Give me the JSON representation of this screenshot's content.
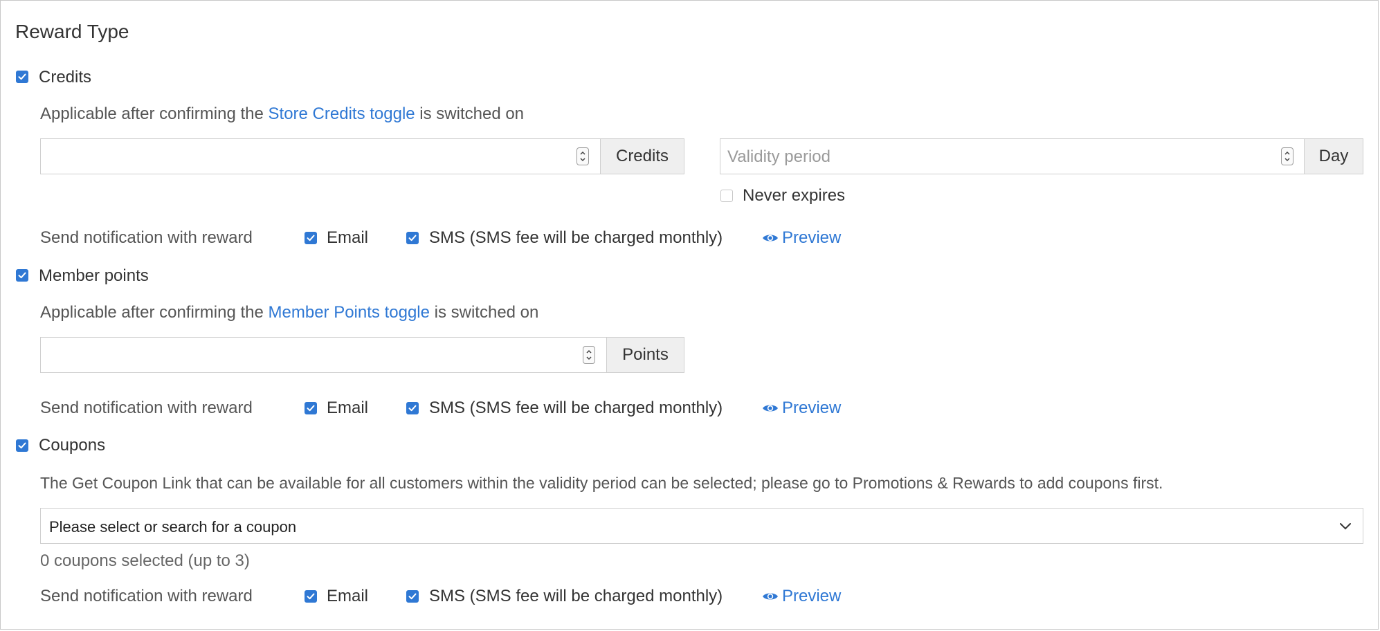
{
  "section_title": "Reward Type",
  "credits": {
    "label": "Credits",
    "checked": true,
    "hint_prefix": "Applicable after confirming the ",
    "hint_link": "Store Credits toggle",
    "hint_suffix": " is switched on",
    "amount_value": "",
    "amount_unit": "Credits",
    "validity_placeholder": "Validity period",
    "validity_unit": "Day",
    "never_expires_label": "Never expires",
    "never_expires_checked": false
  },
  "member_points": {
    "label": "Member points",
    "checked": true,
    "hint_prefix": "Applicable after confirming the ",
    "hint_link": "Member Points toggle",
    "hint_suffix": " is switched on",
    "amount_value": "",
    "amount_unit": "Points"
  },
  "coupons": {
    "label": "Coupons",
    "checked": true,
    "hint": "The Get Coupon Link that can be available for all customers within the validity period can be selected; please go to Promotions & Rewards to add coupons first.",
    "select_placeholder": "Please select or search for a coupon",
    "selected_count": "0 coupons selected (up to 3)"
  },
  "notification": {
    "label": "Send notification with reward",
    "email_label": "Email",
    "sms_label": "SMS (SMS fee will be charged monthly)",
    "preview_label": "Preview"
  },
  "colors": {
    "accent": "#2f78d4",
    "text": "#333333",
    "border": "#cfcfcf",
    "addon_bg": "#efefef"
  }
}
